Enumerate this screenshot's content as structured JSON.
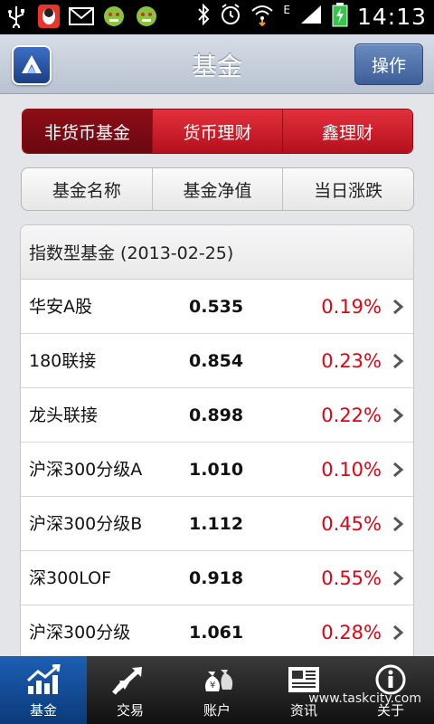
{
  "status_bar": {
    "time": "14:13",
    "network_label": "E",
    "icons": [
      "usb-icon",
      "qq-icon",
      "mail-icon",
      "android-alert-icon",
      "android-alert-icon",
      "bluetooth-icon",
      "alarm-icon",
      "wifi-icon",
      "signal-icon",
      "battery-charging-icon"
    ]
  },
  "header": {
    "title": "基金",
    "action_button": "操作",
    "logo_icon": "app-logo-icon"
  },
  "segment_tabs": [
    {
      "label": "非货币基金",
      "active": true
    },
    {
      "label": "货币理财",
      "active": false
    },
    {
      "label": "鑫理财",
      "active": false
    }
  ],
  "sort_header": {
    "columns": [
      "基金名称",
      "基金净值",
      "当日涨跌"
    ]
  },
  "fund_list": {
    "group_title": "指数型基金 (2013-02-25)",
    "rows": [
      {
        "name": "华安A股",
        "nav": "0.535",
        "change": "0.19%"
      },
      {
        "name": "180联接",
        "nav": "0.854",
        "change": "0.23%"
      },
      {
        "name": "龙头联接",
        "nav": "0.898",
        "change": "0.22%"
      },
      {
        "name": "沪深300分级A",
        "nav": "1.010",
        "change": "0.10%"
      },
      {
        "name": "沪深300分级B",
        "nav": "1.112",
        "change": "0.45%"
      },
      {
        "name": "深300LOF",
        "nav": "0.918",
        "change": "0.55%"
      },
      {
        "name": "沪深300分级",
        "nav": "1.061",
        "change": "0.28%"
      }
    ]
  },
  "bottom_nav": {
    "items": [
      {
        "label": "基金",
        "icon": "chart-up-icon",
        "active": true
      },
      {
        "label": "交易",
        "icon": "exchange-arrows-icon",
        "active": false
      },
      {
        "label": "账户",
        "icon": "money-bag-icon",
        "active": false
      },
      {
        "label": "资讯",
        "icon": "newspaper-icon",
        "active": false
      },
      {
        "label": "关于",
        "icon": "info-icon",
        "active": false
      }
    ]
  },
  "watermark": "www.taskcity.com",
  "colors": {
    "accent_red": "#e60012",
    "tab_red": "#c81b27",
    "nav_active_blue": "#1c5fb3"
  }
}
